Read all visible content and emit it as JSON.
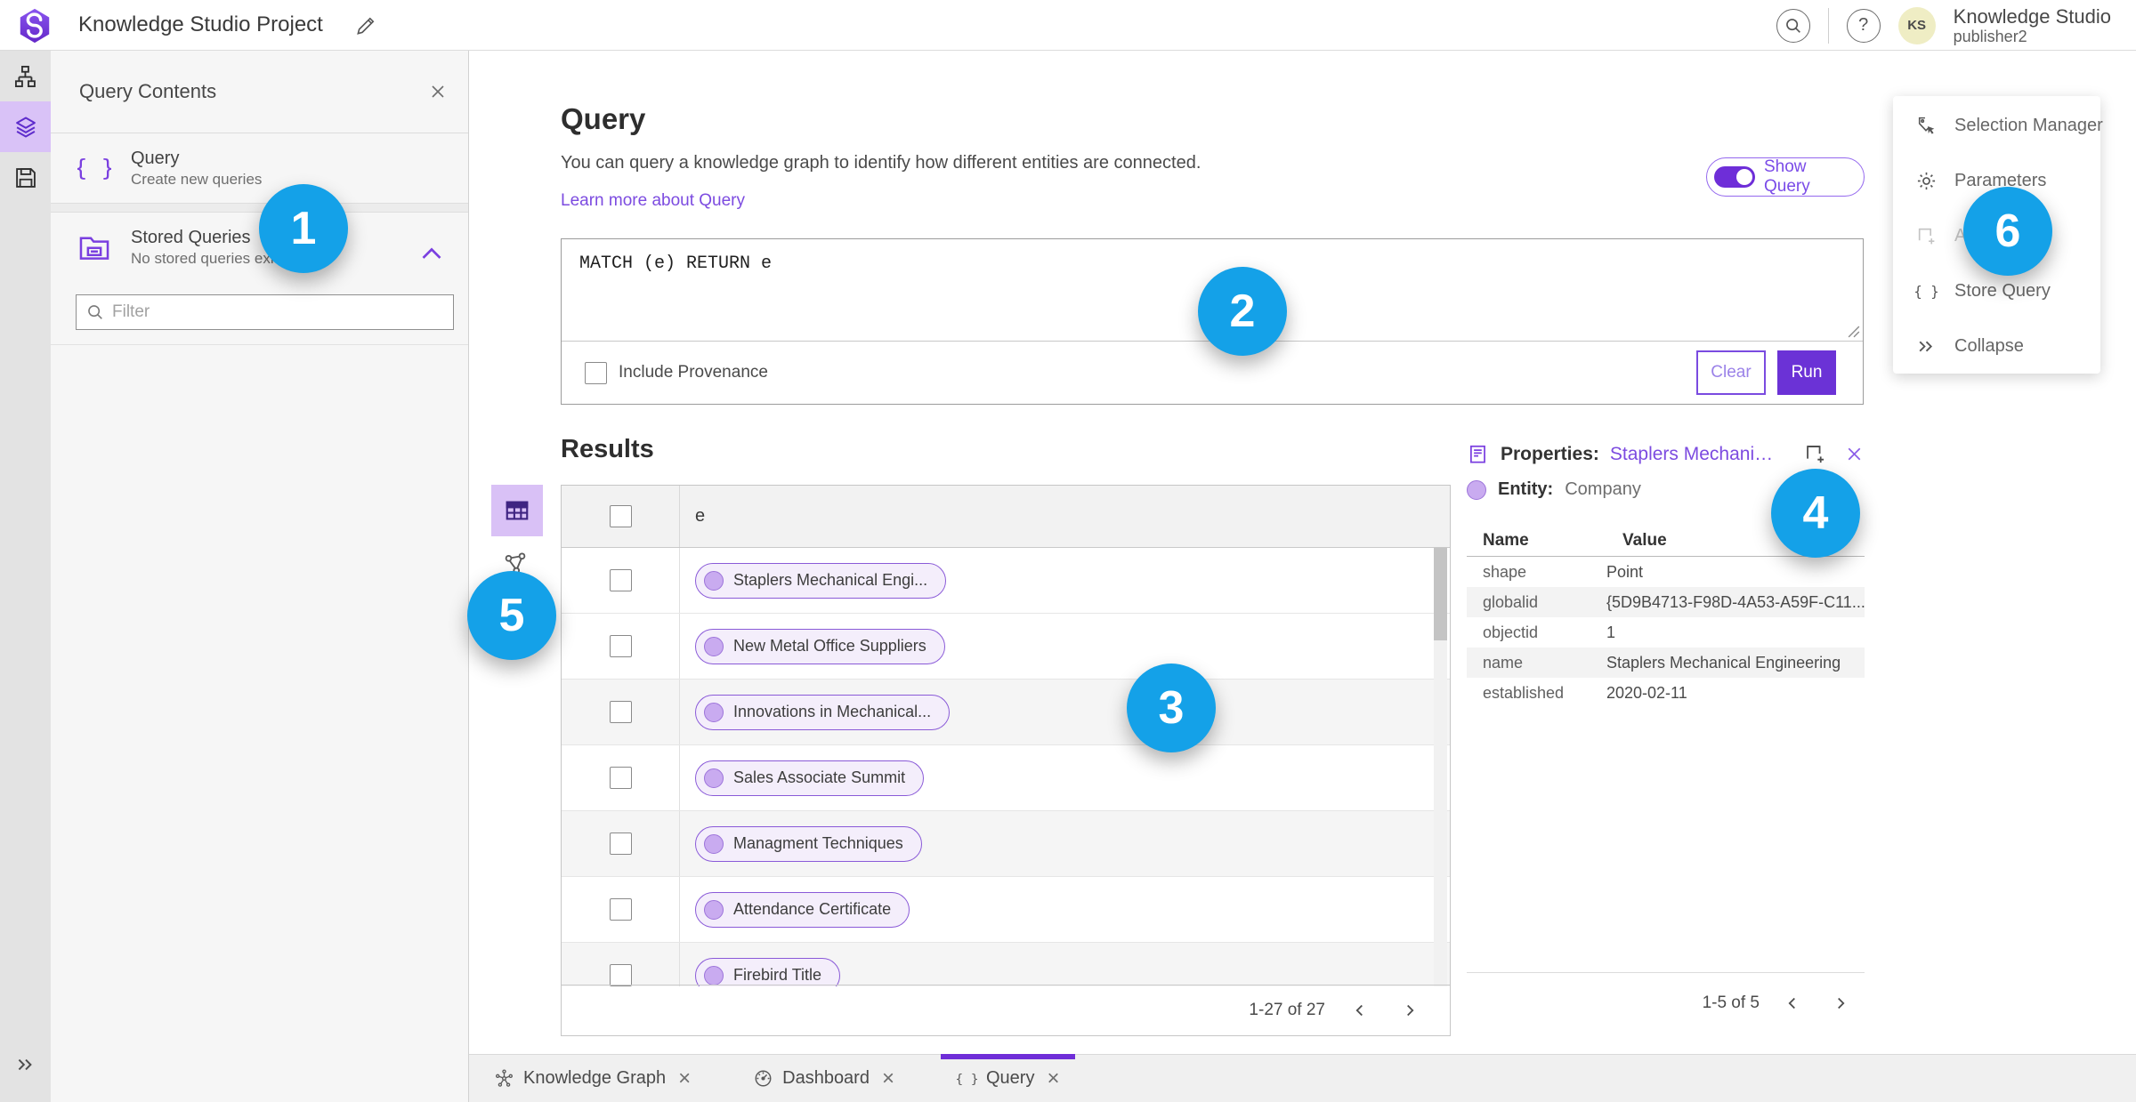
{
  "topbar": {
    "title": "Knowledge Studio Project",
    "user": {
      "initials": "KS",
      "name": "Knowledge Studio",
      "subtitle": "publisher2"
    },
    "icons": [
      "search-icon",
      "help-icon",
      "edit-pencil-icon"
    ]
  },
  "rail": {
    "items": [
      {
        "icon": "sitemap-icon",
        "active": false
      },
      {
        "icon": "layers-icon",
        "active": true
      },
      {
        "icon": "save-icon",
        "active": false
      }
    ],
    "expand_icon": "double-chevron-right-icon"
  },
  "left_panel": {
    "title": "Query Contents",
    "close_icon": "close-icon",
    "query_item": {
      "icon": "braces-icon",
      "label": "Query",
      "sublabel": "Create new queries"
    },
    "stored_item": {
      "icon": "stored-queries-folder-icon",
      "label": "Stored Queries",
      "sublabel": "No stored queries exist",
      "collapse_icon": "chevron-up-icon"
    },
    "filter_placeholder": "Filter"
  },
  "query_section": {
    "title": "Query",
    "description": "You can query a knowledge graph to identify how different entities are connected.",
    "link_label": "Learn more about Query",
    "toggle_label": "Show Query",
    "toggle_on": true,
    "query_text": "MATCH (e) RETURN e",
    "include_provenance_label": "Include Provenance",
    "provenance_checked": false,
    "clear_label": "Clear",
    "run_label": "Run"
  },
  "results": {
    "title": "Results",
    "view_icons": [
      "table-icon",
      "link-chart-icon"
    ],
    "column_header": "e",
    "rows": [
      "Staplers Mechanical Engi...",
      "New Metal Office Suppliers",
      "Innovations in Mechanical...",
      "Sales Associate Summit",
      "Managment Techniques",
      "Attendance Certificate",
      "Firebird Title"
    ],
    "pagination": "1-27 of 27"
  },
  "properties": {
    "title": "Properties:",
    "entity_link": "Staplers Mechanic...",
    "header_icons": [
      "add-to-map-icon",
      "close-icon"
    ],
    "entity_label": "Entity:",
    "entity_type": "Company",
    "columns": {
      "name": "Name",
      "value": "Value"
    },
    "rows": [
      {
        "name": "shape",
        "value": "Point"
      },
      {
        "name": "globalid",
        "value": "{5D9B4713-F98D-4A53-A59F-C11..."
      },
      {
        "name": "objectid",
        "value": "1"
      },
      {
        "name": "name",
        "value": "Staplers Mechanical Engineering"
      },
      {
        "name": "established",
        "value": "2020-02-11"
      }
    ],
    "pagination": "1-5 of 5"
  },
  "side_menu": {
    "items": [
      {
        "icon": "selection-manager-icon",
        "label": "Selection Manager",
        "disabled": false
      },
      {
        "icon": "gear-icon",
        "label": "Parameters",
        "disabled": false
      },
      {
        "icon": "add-to-map-icon",
        "label": "Add To Map",
        "disabled": true
      },
      {
        "icon": "braces-icon",
        "label": "Store Query",
        "disabled": false
      },
      {
        "icon": "double-chevron-right-icon",
        "label": "Collapse",
        "disabled": false
      }
    ]
  },
  "tabs": [
    {
      "icon": "knowledge-graph-icon",
      "label": "Knowledge Graph",
      "active": false
    },
    {
      "icon": "dashboard-icon",
      "label": "Dashboard",
      "active": false
    },
    {
      "icon": "braces-icon",
      "label": "Query",
      "active": true
    }
  ],
  "annotations": [
    "1",
    "2",
    "3",
    "4",
    "5",
    "6"
  ],
  "colors": {
    "accent_purple": "#6e2ed8",
    "link_purple": "#7c4be0",
    "selected_purple_bg": "#d9c2f7",
    "pill_bg": "#f4eefb",
    "pill_border": "#8a5ad8",
    "annotation_blue": "#14a1e8",
    "avatar_bg": "#efedc4"
  }
}
